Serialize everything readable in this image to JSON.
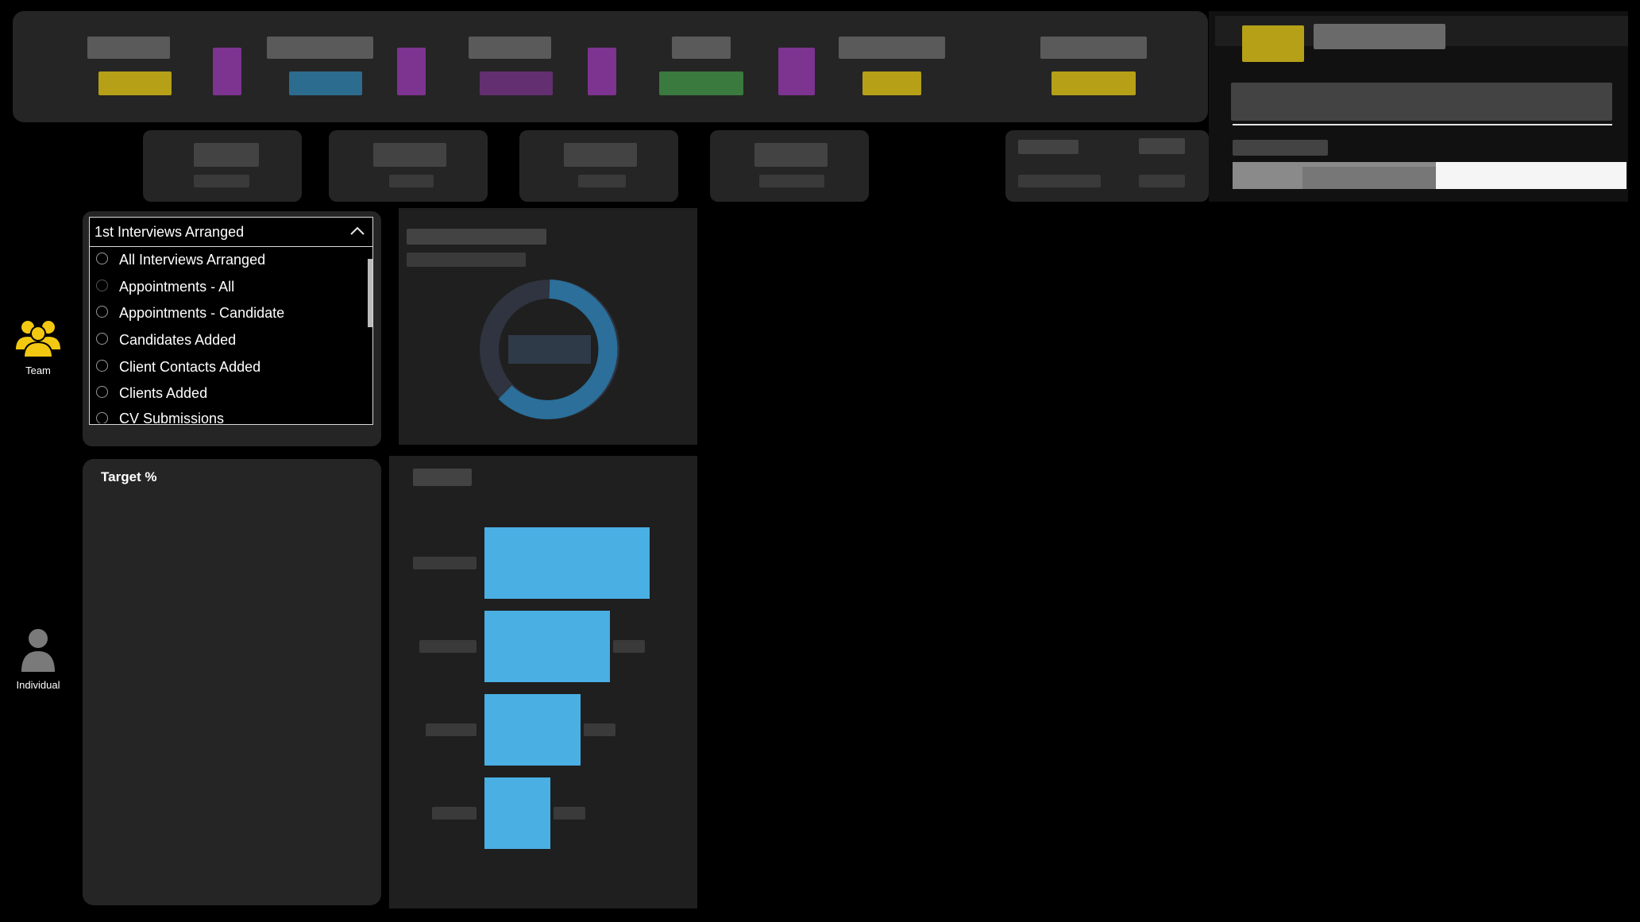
{
  "nav": {
    "team_label": "Team",
    "individual_label": "Individual"
  },
  "slicer": {
    "selected": "1st Interviews Arranged",
    "options": [
      "All Interviews Arranged",
      "Appointments - All",
      "Appointments - Candidate",
      "Candidates Added",
      "Client Contacts Added",
      "Clients Added",
      "CV Submissions"
    ]
  },
  "target_card": {
    "title": "Target %"
  },
  "chart_data": {
    "type": "bar",
    "orientation": "horizontal",
    "categories": [
      "",
      "",
      "",
      ""
    ],
    "values": [
      100,
      76,
      58,
      40
    ],
    "color": "#4aafe2"
  },
  "colors": {
    "team_icon": "#f2c811",
    "individual_icon": "#7a7a7a",
    "bar": "#4aafe2",
    "card_bg": "#252525"
  }
}
